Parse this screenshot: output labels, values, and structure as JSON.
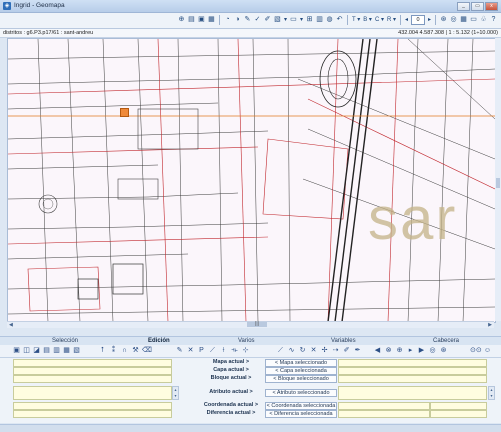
{
  "window": {
    "title": "Ingrid - Geomapa",
    "buttons": [
      "_",
      "▭",
      "x"
    ]
  },
  "toolbar": {
    "items": [
      {
        "name": "zoom-in-icon",
        "glyph": "⊕"
      },
      {
        "name": "print-icon",
        "glyph": "▤"
      },
      {
        "name": "screen-icon",
        "glyph": "▣"
      },
      {
        "name": "save-icon",
        "glyph": "▦"
      },
      {
        "sep": true
      },
      {
        "name": "display-icon",
        "glyph": "◔"
      },
      {
        "name": "contrast-icon",
        "glyph": "◑"
      },
      {
        "name": "pencil-icon",
        "glyph": "✎"
      },
      {
        "name": "pencil-check-icon",
        "glyph": "✓"
      },
      {
        "name": "pencil-brush-icon",
        "glyph": "✐"
      },
      {
        "name": "layers-icon",
        "glyph": "▧",
        "drop": "▾"
      },
      {
        "name": "rect-select-icon",
        "glyph": "▭",
        "drop": "▾"
      },
      {
        "name": "grid-icon",
        "glyph": "⊞"
      },
      {
        "name": "table-icon",
        "glyph": "▥"
      },
      {
        "name": "palette-icon",
        "glyph": "◍"
      },
      {
        "name": "undo-icon",
        "glyph": "↶"
      },
      {
        "sep": true
      }
    ],
    "dropdowns": [
      {
        "name": "text-dropdown",
        "label": "T",
        "arrow": "▾"
      },
      {
        "name": "b-dropdown",
        "label": "B",
        "arrow": "▾"
      },
      {
        "name": "c-dropdown",
        "label": "C",
        "arrow": "▾"
      },
      {
        "name": "r-dropdown",
        "label": "R",
        "arrow": "▾"
      }
    ],
    "counter_value": "0",
    "right_items": [
      {
        "name": "zoom-extent-icon",
        "glyph": "⊛"
      },
      {
        "name": "target-icon",
        "glyph": "◎"
      },
      {
        "name": "props-icon",
        "glyph": "▦"
      },
      {
        "name": "window-icon",
        "glyph": "▭"
      },
      {
        "name": "tree-icon",
        "glyph": "♧"
      },
      {
        "name": "help-icon",
        "glyph": "?"
      }
    ]
  },
  "infobar": {
    "path": "distritos : g6.P3.p17/61 : sant-andreu",
    "coords": "432.004  4.587.308 | 1 : 5.132 (1÷10.000)"
  },
  "map": {
    "big_label": "sar",
    "marker": "selected-feature"
  },
  "tabs": [
    {
      "name": "tab-seleccion",
      "label": "Selección",
      "active": false
    },
    {
      "name": "tab-edicion",
      "label": "Edición",
      "active": true
    },
    {
      "name": "tab-varios",
      "label": "Varios",
      "active": false
    },
    {
      "name": "tab-variables",
      "label": "Variables",
      "active": false
    },
    {
      "name": "tab-cabecera",
      "label": "Cabecera",
      "active": false
    }
  ],
  "panel_icons": {
    "seleccion": [
      {
        "name": "select-box-icon",
        "glyph": "▣"
      },
      {
        "name": "select-lasso-icon",
        "glyph": "◫"
      },
      {
        "name": "select-circle-icon",
        "glyph": "◪"
      },
      {
        "name": "select-layer-icon",
        "glyph": "▤"
      },
      {
        "name": "select-attr-icon",
        "glyph": "▥"
      },
      {
        "name": "select-sql-icon",
        "glyph": "▦"
      },
      {
        "name": "select-buffer-icon",
        "glyph": "▧"
      }
    ],
    "seleccion_tools": [
      {
        "name": "point-tool-icon",
        "glyph": "⭡"
      },
      {
        "name": "pick-tool-icon",
        "glyph": "⁑"
      },
      {
        "name": "magnet-icon",
        "glyph": "∩"
      },
      {
        "name": "hammer-icon",
        "glyph": "⚒"
      },
      {
        "name": "eraser-icon",
        "glyph": "⌫"
      }
    ],
    "edicion": [
      {
        "name": "edit-pencil-icon",
        "glyph": "✎"
      },
      {
        "name": "edit-delete-icon",
        "glyph": "✕"
      },
      {
        "name": "edit-point-icon",
        "glyph": "P"
      },
      {
        "name": "edit-line-icon",
        "glyph": "⟋"
      },
      {
        "name": "edit-join-icon",
        "glyph": "⟊"
      },
      {
        "name": "edit-split-icon",
        "glyph": "⟛"
      },
      {
        "name": "edit-node-icon",
        "glyph": "⊹"
      }
    ],
    "varios": [
      {
        "name": "draw-line-icon",
        "glyph": "⟋"
      },
      {
        "name": "draw-curve-icon",
        "glyph": "∿"
      },
      {
        "name": "rotate-icon",
        "glyph": "↻"
      },
      {
        "name": "cross-icon",
        "glyph": "✕"
      },
      {
        "name": "move-icon",
        "glyph": "✢"
      },
      {
        "name": "arrow-icon",
        "glyph": "⇢"
      },
      {
        "name": "paint-icon",
        "glyph": "✐"
      },
      {
        "name": "brush-icon",
        "glyph": "✒"
      }
    ],
    "variables": [
      {
        "name": "var-play-icon",
        "glyph": "◀"
      },
      {
        "name": "var-merge-icon",
        "glyph": "⊗"
      },
      {
        "name": "var-add-icon",
        "glyph": "⊕"
      },
      {
        "name": "var-step-icon",
        "glyph": "▸"
      },
      {
        "name": "var-next-icon",
        "glyph": "▶"
      },
      {
        "name": "var-locate-icon",
        "glyph": "◎"
      },
      {
        "name": "var-target-icon",
        "glyph": "⊛"
      }
    ],
    "cabecera": [
      {
        "name": "binoculars-icon",
        "glyph": "⊙⊙"
      },
      {
        "name": "users-icon",
        "glyph": "☺"
      }
    ]
  },
  "fields": [
    {
      "label": "Mapa actual >",
      "button": "< Mapa seleccionado"
    },
    {
      "label": "Capa actual >",
      "button": "< Capa seleccionada"
    },
    {
      "label": "Bloque actual >",
      "button": "< Bloque seleccionado"
    },
    {
      "label": "Atributo actual >",
      "button": "< Atributo seleccionado"
    },
    {
      "label": "Coordenada actual >",
      "button": "< Coordenada seleccionada"
    },
    {
      "label": "Diferencia actual >",
      "button": "< Diferencia seleccionada"
    }
  ]
}
